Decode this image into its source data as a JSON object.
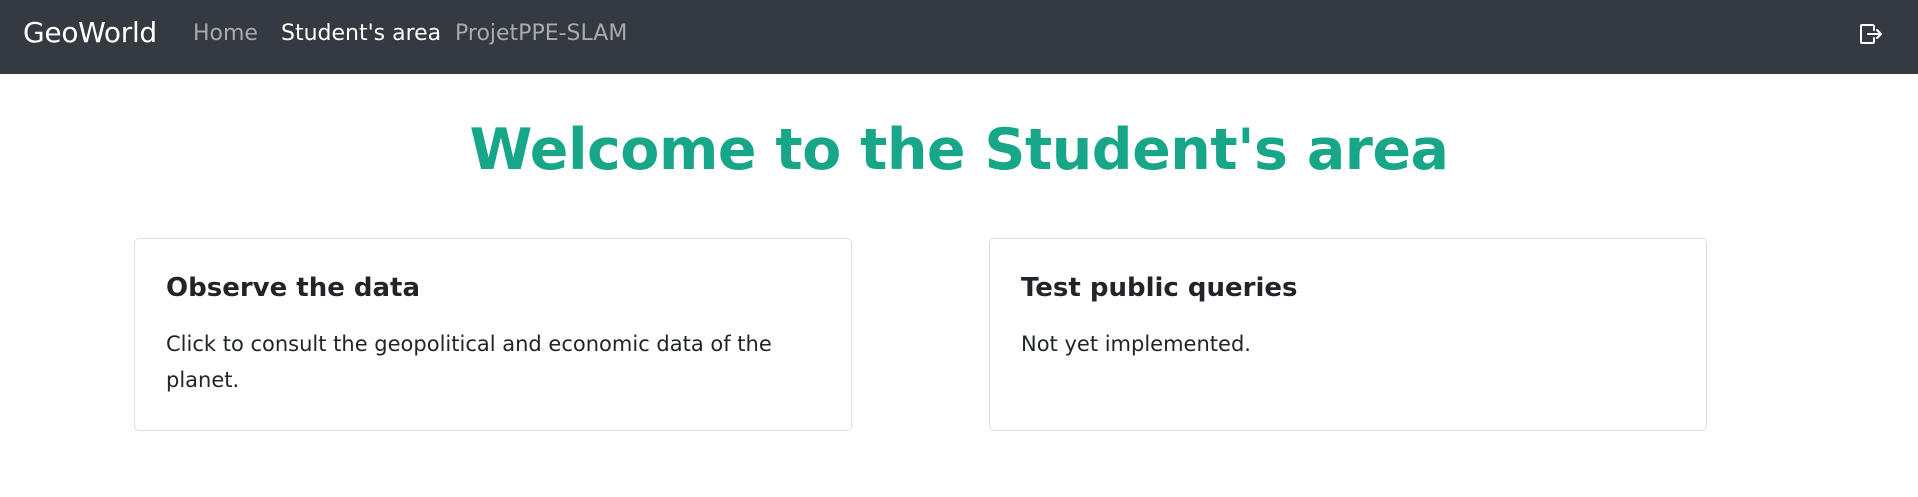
{
  "navbar": {
    "brand": "GeoWorld",
    "links": [
      {
        "label": "Home",
        "active": false
      },
      {
        "label": "Student's area",
        "active": true
      },
      {
        "label": "ProjetPPE-SLAM",
        "active": false
      }
    ],
    "logout_icon": "sign-out-icon"
  },
  "main": {
    "title": "Welcome to the Student's area",
    "cards": [
      {
        "title": "Observe the data",
        "text": "Click to consult the geopolitical and economic data of the planet."
      },
      {
        "title": "Test public queries",
        "text": "Not yet implemented."
      }
    ]
  },
  "colors": {
    "navbar_bg": "#343a40",
    "title": "#18a689",
    "nav_inactive": "#a7abaf",
    "nav_active": "#ffffff"
  }
}
